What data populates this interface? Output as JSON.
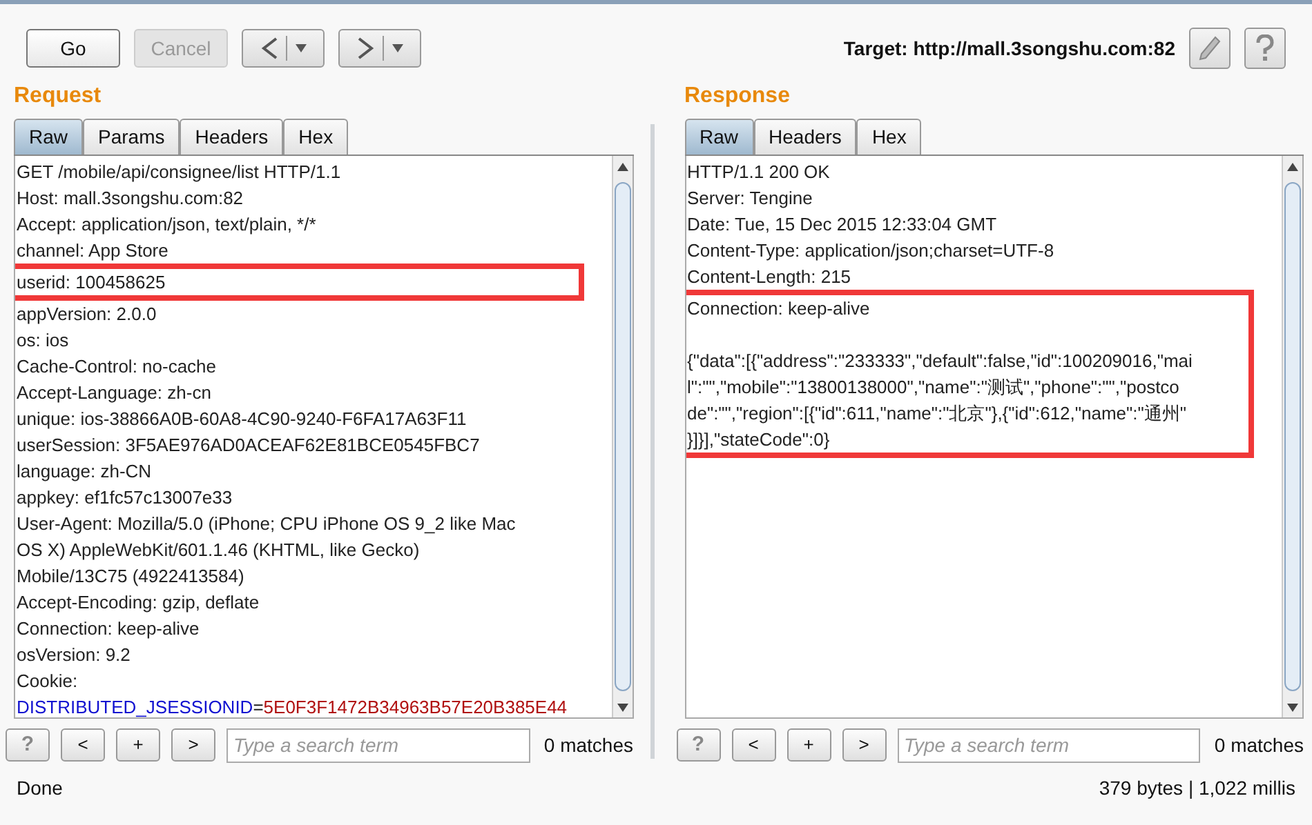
{
  "toolbar": {
    "buttons": [
      {
        "label": "Go",
        "disabled": false
      },
      {
        "label": "Cancel",
        "disabled": true
      }
    ],
    "history": [
      {
        "kind": "back"
      },
      {
        "kind": "forward"
      }
    ],
    "target": "Target: http://mall.3songshu.com:82"
  },
  "request": {
    "title": "Request",
    "tabs": [
      {
        "label": "Raw",
        "selected": true
      },
      {
        "label": "Params",
        "selected": false
      },
      {
        "label": "Headers",
        "selected": false
      },
      {
        "label": "Hex",
        "selected": false
      }
    ],
    "blocks": [
      {
        "boxed": false,
        "lines": [
          {
            "text": "GET /mobile/api/consignee/list HTTP/1.1"
          },
          {
            "text": "Host: mall.3songshu.com:82"
          },
          {
            "text": "Accept: application/json, text/plain, */*"
          },
          {
            "text": "channel: App Store"
          }
        ]
      },
      {
        "boxed": true,
        "lines": [
          {
            "text": "userid: 100458625"
          }
        ]
      },
      {
        "boxed": false,
        "lines": [
          {
            "text": "appVersion: 2.0.0"
          },
          {
            "text": "os: ios"
          },
          {
            "text": "Cache-Control: no-cache"
          },
          {
            "text": "Accept-Language: zh-cn"
          },
          {
            "text": "unique: ios-38866A0B-60A8-4C90-9240-F6FA17A63F11"
          },
          {
            "text": "userSession: 3F5AE976AD0ACEAF62E81BCE0545FBC7"
          },
          {
            "text": "language: zh-CN"
          },
          {
            "text": "appkey: ef1fc57c13007e33"
          },
          {
            "text": "User-Agent: Mozilla/5.0 (iPhone; CPU iPhone OS 9_2 like Mac"
          },
          {
            "text": "OS X) AppleWebKit/601.1.46 (KHTML, like Gecko)"
          },
          {
            "text": "Mobile/13C75 (4922413584)"
          },
          {
            "text": "Accept-Encoding: gzip, deflate"
          },
          {
            "text": "Connection: keep-alive"
          },
          {
            "text": "osVersion: 9.2"
          },
          {
            "text": "Cookie:"
          },
          {
            "cookie_name": "DISTRIBUTED_JSESSIONID",
            "separator": "=",
            "cookie_value": "5E0F3F1472B34963B57E20B385E44"
          }
        ]
      }
    ],
    "search": {
      "buttons": [
        "?",
        "<",
        "+",
        ">"
      ],
      "placeholder": "Type a search term",
      "matches": "0 matches"
    }
  },
  "response": {
    "title": "Response",
    "tabs": [
      {
        "label": "Raw",
        "selected": true
      },
      {
        "label": "Headers",
        "selected": false
      },
      {
        "label": "Hex",
        "selected": false
      }
    ],
    "blocks": [
      {
        "boxed": false,
        "lines": [
          {
            "text": "HTTP/1.1 200 OK"
          },
          {
            "text": "Server: Tengine"
          },
          {
            "text": "Date: Tue, 15 Dec 2015 12:33:04 GMT"
          },
          {
            "text": "Content-Type: application/json;charset=UTF-8"
          },
          {
            "text": "Content-Length: 215"
          }
        ]
      },
      {
        "boxed": true,
        "lines": [
          {
            "text": "Connection: keep-alive"
          }
        ]
      },
      {
        "boxed": true,
        "joined": true,
        "lines": [
          {
            "text": "{\"data\":[{\"address\":\"233333\",\"default\":false,\"id\":100209016,\"mai"
          },
          {
            "text": "l\":\"\",\"mobile\":\"13800138000\",\"name\":\"测试\",\"phone\":\"\",\"postco"
          },
          {
            "text": "de\":\"\",\"region\":[{\"id\":611,\"name\":\"北京\"},{\"id\":612,\"name\":\"通州\""
          },
          {
            "text": "}]}],\"stateCode\":0}"
          }
        ]
      }
    ],
    "search": {
      "buttons": [
        "?",
        "<",
        "+",
        ">"
      ],
      "placeholder": "Type a search term",
      "matches": "0 matches"
    }
  },
  "status_bar": {
    "left": "Done",
    "right": "379 bytes | 1,022 millis"
  }
}
